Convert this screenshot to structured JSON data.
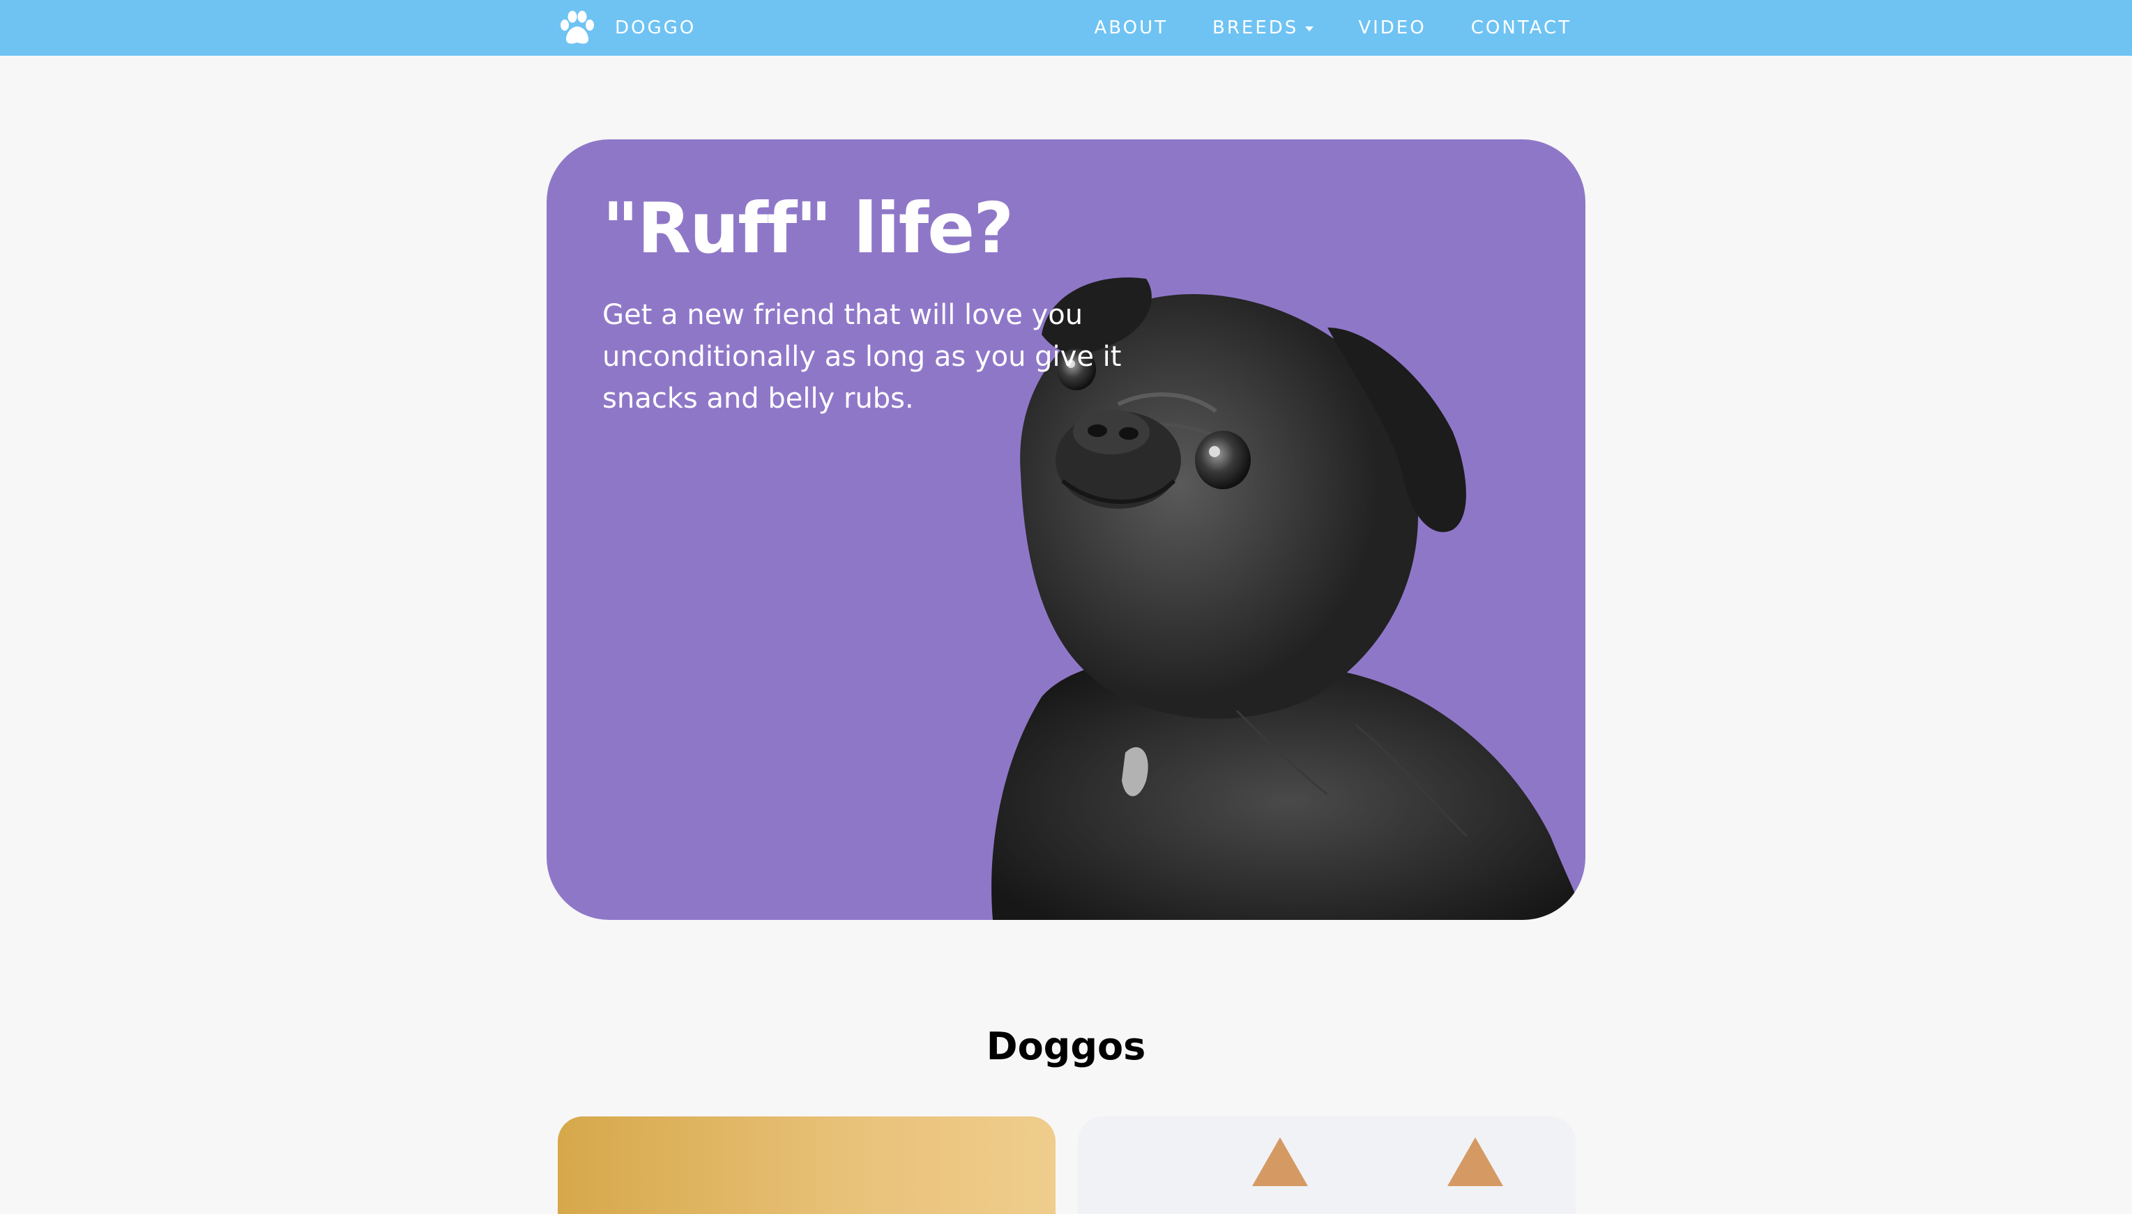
{
  "navbar": {
    "brand": "DOGGO",
    "links": [
      {
        "label": "ABOUT"
      },
      {
        "label": "BREEDS",
        "dropdown": true
      },
      {
        "label": "VIDEO"
      },
      {
        "label": "CONTACT"
      }
    ],
    "background": "#6fc3f3",
    "brand_icon": "paw-icon"
  },
  "hero": {
    "title": "\"Ruff\" life?",
    "text": "Get a new friend that will love you unconditionally as long as you give it snacks and belly rubs.",
    "background": "#8f77c8",
    "image": "pug-photo"
  },
  "section": {
    "title": "Doggos"
  },
  "cards": [
    {
      "image": "golden-dog-photo"
    },
    {
      "image": "corgi-photo"
    }
  ]
}
